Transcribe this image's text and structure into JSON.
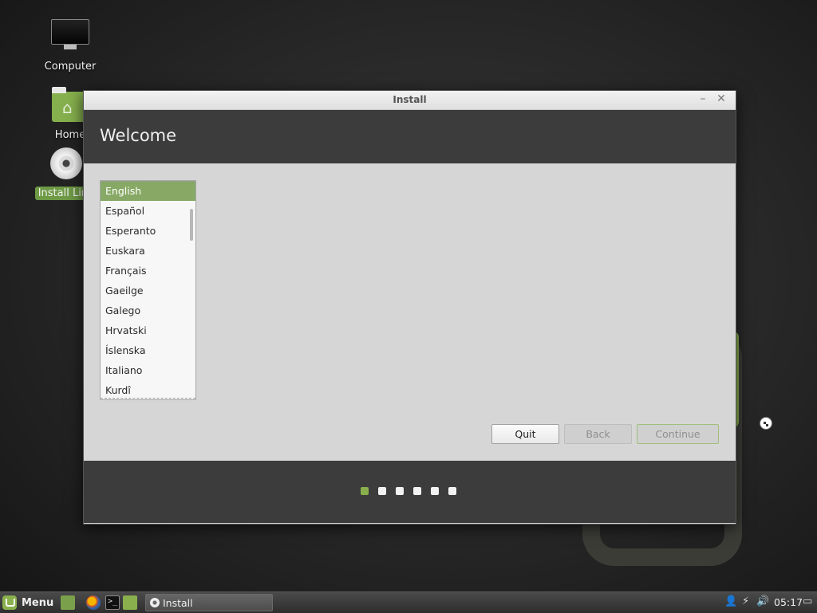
{
  "desktop": {
    "icons": [
      {
        "label": "Computer"
      },
      {
        "label": "Home"
      },
      {
        "label": "Install Linu"
      }
    ]
  },
  "window": {
    "title": "Install",
    "minimize_glyph": "–",
    "close_glyph": "✕",
    "heading": "Welcome",
    "languages": [
      "English",
      "Español",
      "Esperanto",
      "Euskara",
      "Français",
      "Gaeilge",
      "Galego",
      "Hrvatski",
      "Íslenska",
      "Italiano",
      "Kurdî"
    ],
    "selected_language": "English",
    "buttons": {
      "quit": "Quit",
      "back": "Back",
      "continue": "Continue"
    },
    "progress": {
      "total_steps": 6,
      "current_step": 1
    }
  },
  "taskbar": {
    "menu_label": "Menu",
    "terminal_glyph": ">_",
    "task_label": "Install",
    "clock": "05:17",
    "tray_icons": [
      "user-icon",
      "network-icon",
      "volume-icon",
      "display-icon"
    ]
  },
  "colors": {
    "accent": "#8ab04e",
    "selection": "#87a965",
    "header_bg": "#3c3c3c"
  }
}
